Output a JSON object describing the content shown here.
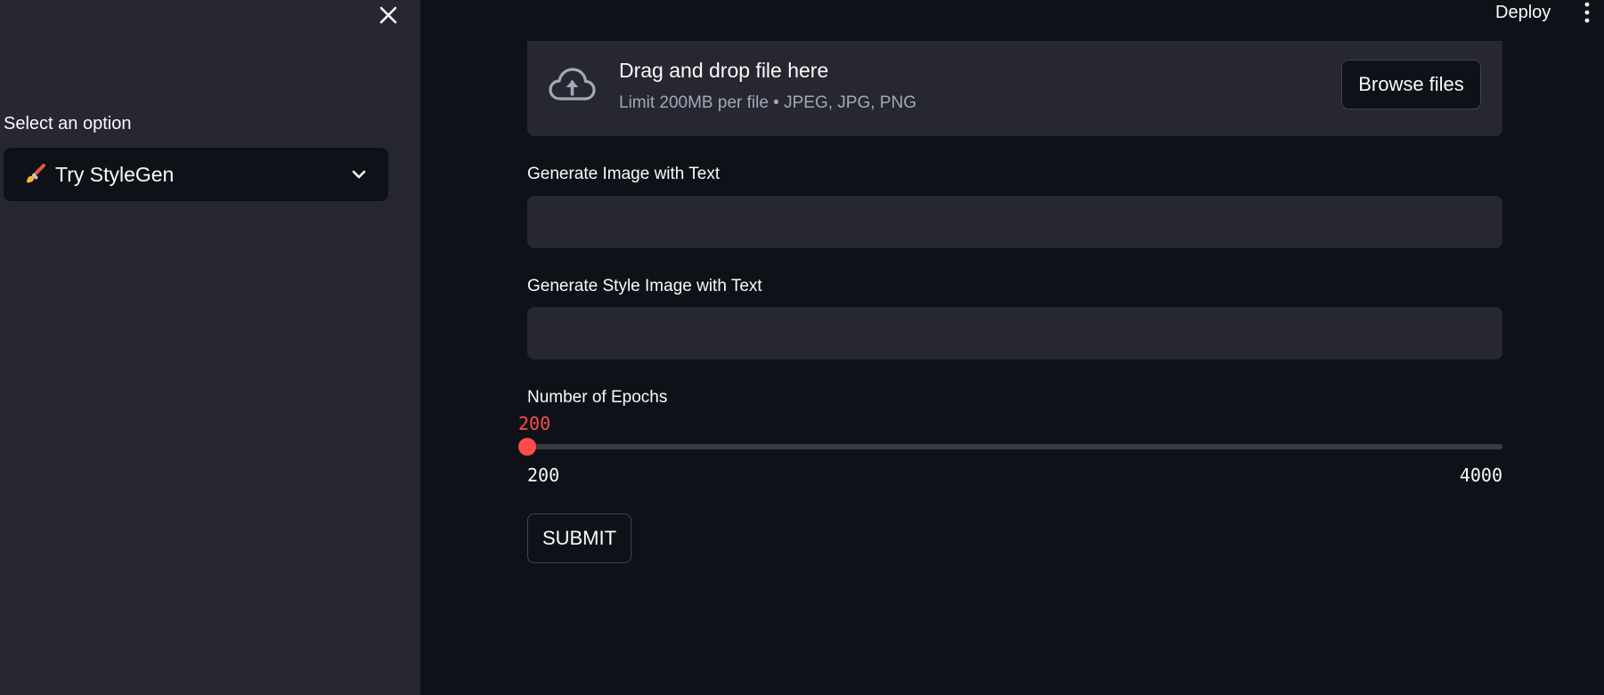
{
  "header": {
    "deploy_label": "Deploy",
    "menu_icon": "kebab-menu-icon"
  },
  "sidebar": {
    "close_icon": "close-icon",
    "select_label": "Select an option",
    "select_value": "Try StyleGen",
    "select_icon": "paintbrush-icon"
  },
  "uploader": {
    "title": "Drag and drop file here",
    "subtitle": "Limit 200MB per file • JPEG, JPG, PNG",
    "browse_label": "Browse files",
    "icon": "cloud-upload-icon"
  },
  "fields": {
    "image_text_label": "Generate Image with Text",
    "image_text_value": "",
    "style_text_label": "Generate Style Image with Text",
    "style_text_value": ""
  },
  "epochs": {
    "label": "Number of Epochs",
    "value": 200,
    "min": 200,
    "max": 4000
  },
  "submit_label": "SUBMIT",
  "colors": {
    "accent": "#ff4b4b",
    "background": "#0e1117",
    "sidebar": "#262730"
  }
}
